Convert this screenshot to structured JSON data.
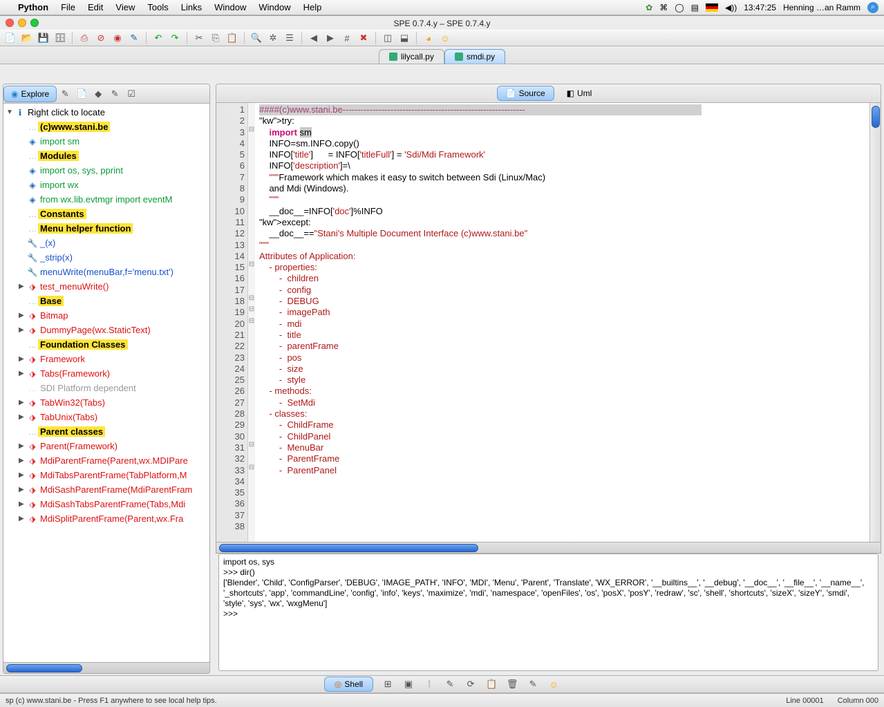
{
  "menubar": {
    "appname": "Python",
    "items": [
      "File",
      "Edit",
      "View",
      "Tools",
      "Links",
      "Window",
      "Window",
      "Help"
    ],
    "clock": "13:47:25",
    "user": "Henning …an Ramm"
  },
  "window": {
    "title": "SPE 0.7.4.y – SPE 0.7.4.y"
  },
  "filetabs": {
    "tabs": [
      {
        "label": "lilycall.py",
        "active": false
      },
      {
        "label": "smdi.py",
        "active": true
      }
    ]
  },
  "sidebar": {
    "activeTab": "Explore",
    "rootLabel": "Right click to locate",
    "items": [
      {
        "label": "(c)www.stani.be",
        "kind": "section",
        "icon": ""
      },
      {
        "label": "import sm",
        "kind": "import",
        "icon": "◈"
      },
      {
        "label": "Modules",
        "kind": "section",
        "icon": ""
      },
      {
        "label": "import  os, sys, pprint",
        "kind": "import",
        "icon": "◈"
      },
      {
        "label": "import  wx",
        "kind": "import",
        "icon": "◈"
      },
      {
        "label": "from   wx.lib.evtmgr import eventM",
        "kind": "import",
        "icon": "◈"
      },
      {
        "label": "Constants",
        "kind": "section",
        "icon": ""
      },
      {
        "label": "Menu helper function",
        "kind": "section",
        "icon": ""
      },
      {
        "label": "_(x)",
        "kind": "func",
        "icon": "🔧"
      },
      {
        "label": "_strip(x)",
        "kind": "func",
        "icon": "🔧"
      },
      {
        "label": "menuWrite(menuBar,f='menu.txt')",
        "kind": "func",
        "icon": "🔧"
      },
      {
        "label": "test_menuWrite()",
        "kind": "class",
        "icon": "⬗",
        "expandable": true
      },
      {
        "label": "Base",
        "kind": "section",
        "icon": ""
      },
      {
        "label": "Bitmap",
        "kind": "class",
        "icon": "⬗",
        "expandable": true
      },
      {
        "label": "DummyPage(wx.StaticText)",
        "kind": "class",
        "icon": "⬗",
        "expandable": true
      },
      {
        "label": "Foundation Classes",
        "kind": "section",
        "icon": ""
      },
      {
        "label": "Framework",
        "kind": "class",
        "icon": "⬗",
        "expandable": true
      },
      {
        "label": "Tabs(Framework)",
        "kind": "class",
        "icon": "⬗",
        "expandable": true
      },
      {
        "label": "SDI Platform dependent",
        "kind": "gray",
        "icon": ""
      },
      {
        "label": "TabWin32(Tabs)",
        "kind": "class",
        "icon": "⬗",
        "expandable": true
      },
      {
        "label": "TabUnix(Tabs)",
        "kind": "class",
        "icon": "⬗",
        "expandable": true
      },
      {
        "label": "Parent classes",
        "kind": "section",
        "icon": ""
      },
      {
        "label": "Parent(Framework)",
        "kind": "class",
        "icon": "⬗",
        "expandable": true
      },
      {
        "label": "MdiParentFrame(Parent,wx.MDIPare",
        "kind": "class",
        "icon": "⬗",
        "expandable": true
      },
      {
        "label": "MdiTabsParentFrame(TabPlatform,M",
        "kind": "class",
        "icon": "⬗",
        "expandable": true
      },
      {
        "label": "MdiSashParentFrame(MdiParentFram",
        "kind": "class",
        "icon": "⬗",
        "expandable": true
      },
      {
        "label": "MdiSashTabsParentFrame(Tabs,Mdi",
        "kind": "class",
        "icon": "⬗",
        "expandable": true
      },
      {
        "label": "MdiSplitParentFrame(Parent,wx.Fra",
        "kind": "class",
        "icon": "⬗",
        "expandable": true
      }
    ]
  },
  "editorTabs": {
    "tabs": [
      {
        "label": "Source",
        "active": true
      },
      {
        "label": "Uml",
        "active": false
      }
    ]
  },
  "code": {
    "firstLine": 1,
    "lastLine": 38,
    "lines": [
      {
        "t": "####(c)www.stani.be-------------------------------------------------------------",
        "cls": "cmt line1"
      },
      {
        "t": ""
      },
      {
        "t": "try:",
        "fold": "⊟"
      },
      {
        "t": "    import sm"
      },
      {
        "t": "    INFO=sm.INFO.copy()"
      },
      {
        "t": ""
      },
      {
        "t": "    INFO['title']      = INFO['titleFull'] = 'Sdi/Mdi Framework'"
      },
      {
        "t": ""
      },
      {
        "t": "    INFO['description']=\\"
      },
      {
        "t": "    \"\"\"Framework which makes it easy to switch between Sdi (Linux/Mac)"
      },
      {
        "t": "    and Mdi (Windows)."
      },
      {
        "t": "    \"\"\""
      },
      {
        "t": ""
      },
      {
        "t": "    __doc__=INFO['doc']%INFO"
      },
      {
        "t": "except:",
        "fold": "⊟"
      },
      {
        "t": "    __doc__==\"Stani's Multiple Document Interface (c)www.stani.be\""
      },
      {
        "t": ""
      },
      {
        "t": "\"\"\"",
        "fold": "⊟"
      },
      {
        "t": "Attributes of Application:",
        "fold": "⊟"
      },
      {
        "t": "    - properties:",
        "fold": "⊟"
      },
      {
        "t": "        -  children"
      },
      {
        "t": "        -  config"
      },
      {
        "t": "        -  DEBUG"
      },
      {
        "t": "        -  imagePath"
      },
      {
        "t": "        -  mdi"
      },
      {
        "t": "        -  title"
      },
      {
        "t": "        -  parentFrame"
      },
      {
        "t": "        -  pos"
      },
      {
        "t": "        -  size"
      },
      {
        "t": "        -  style"
      },
      {
        "t": "    - methods:",
        "fold": "⊟"
      },
      {
        "t": "        -  SetMdi"
      },
      {
        "t": "    - classes:",
        "fold": "⊟"
      },
      {
        "t": "        -  ChildFrame"
      },
      {
        "t": "        -  ChildPanel"
      },
      {
        "t": "        -  MenuBar"
      },
      {
        "t": "        -  ParentFrame"
      },
      {
        "t": "        -  ParentPanel"
      }
    ]
  },
  "console": {
    "lines": [
      "import os, sys",
      ">>> dir()",
      "['Blender', 'Child', 'ConfigParser', 'DEBUG', 'IMAGE_PATH', 'INFO', 'MDI', 'Menu', 'Parent', 'Translate', 'WX_ERROR', '__builtins__', '__debug', '__doc__', '__file__', '__name__', '_shortcuts', 'app', 'commandLine', 'config', 'info', 'keys', 'maximize', 'mdi', 'namespace', 'openFiles', 'os', 'posX', 'posY', 'redraw', 'sc', 'shell', 'shortcuts', 'sizeX', 'sizeY', 'smdi', 'style', 'sys', 'wx', 'wxgMenu']",
      ">>> "
    ]
  },
  "bottom": {
    "shell": "Shell"
  },
  "status": {
    "left": "sp  (c) www.stani.be - Press F1 anywhere to see local help tips.",
    "line": "Line 00001",
    "col": "Column 000"
  }
}
